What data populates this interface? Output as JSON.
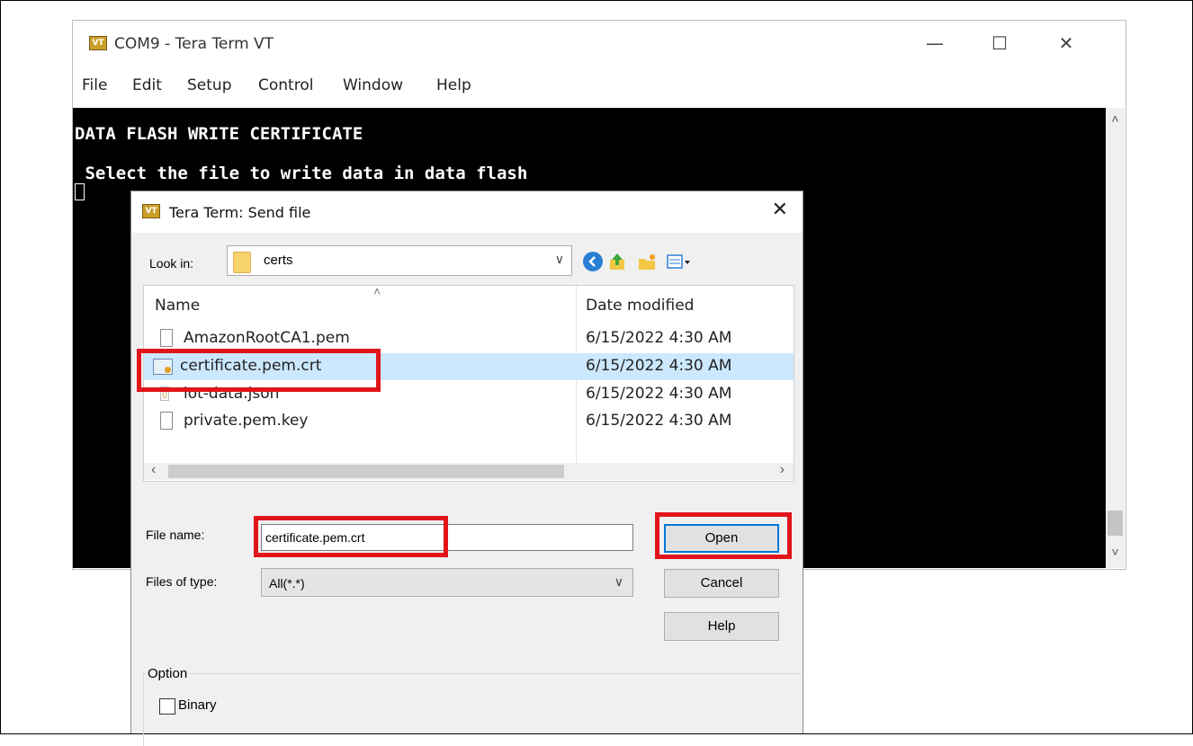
{
  "main_window": {
    "icon": "vt-logo-icon",
    "icon_text": "VT",
    "title": "COM9 - Tera Term VT",
    "controls": {
      "minimize": "—",
      "maximize": "☐",
      "close": "✕"
    },
    "menu": [
      "File",
      "Edit",
      "Setup",
      "Control",
      "Window",
      "Help"
    ]
  },
  "terminal": {
    "lines": [
      "DATA FLASH WRITE CERTIFICATE",
      " Select the file to write data in data flash"
    ]
  },
  "dialog": {
    "title": "Tera Term: Send file",
    "close_icon": "✕",
    "look_in_label": "Look in:",
    "look_in_value": "certs",
    "toolbar_icons": [
      "back-icon",
      "up-folder-icon",
      "new-folder-icon",
      "view-menu-icon"
    ],
    "columns": [
      "Name",
      "Date modified"
    ],
    "files": [
      {
        "name": "AmazonRootCA1.pem",
        "date": "6/15/2022 4:30 AM",
        "icon": "file-icon",
        "selected": false
      },
      {
        "name": "certificate.pem.crt",
        "date": "6/15/2022 4:30 AM",
        "icon": "certificate-icon",
        "selected": true
      },
      {
        "name": "iot-data.json",
        "date": "6/15/2022 4:30 AM",
        "icon": "json-file-icon",
        "selected": false
      },
      {
        "name": "private.pem.key",
        "date": "6/15/2022 4:30 AM",
        "icon": "file-icon",
        "selected": false
      }
    ],
    "file_name_label": "File name:",
    "file_name_value": "certificate.pem.crt",
    "files_of_type_label": "Files of type:",
    "files_of_type_value": "All(*.*)",
    "buttons": {
      "open": "Open",
      "cancel": "Cancel",
      "help": "Help"
    },
    "option_group_label": "Option",
    "binary_label": "Binary",
    "binary_checked": false
  },
  "highlight_color": "#e0151b"
}
